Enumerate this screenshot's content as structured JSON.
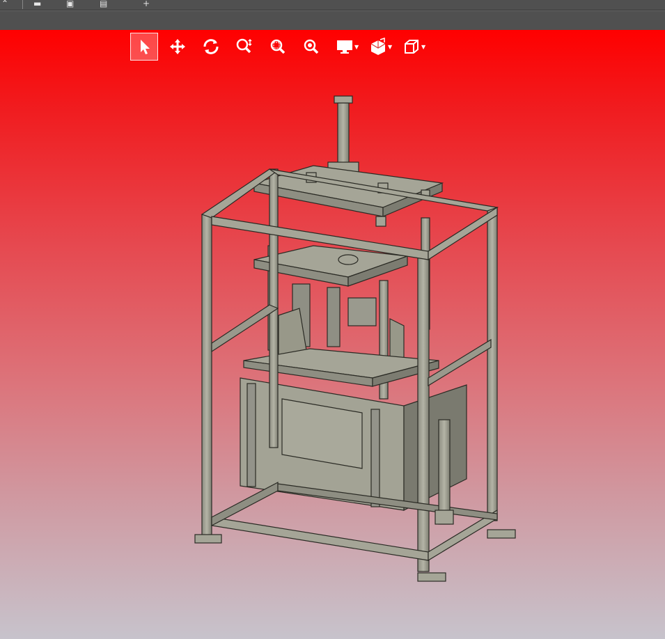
{
  "app": {
    "topbar_icons": [
      "menu-icon",
      "save-icon",
      "print-icon",
      "add-icon"
    ]
  },
  "viewer": {
    "background_top_color": "#ff0000",
    "background_bottom_color": "#c7c3cc",
    "toolbar": [
      {
        "name": "select-tool",
        "icon": "pointer-icon",
        "active": true
      },
      {
        "name": "pan-tool",
        "icon": "move-icon",
        "active": false
      },
      {
        "name": "rotate-tool",
        "icon": "rotate-icon",
        "active": false
      },
      {
        "name": "zoom-tool",
        "icon": "zoom-icon",
        "active": false
      },
      {
        "name": "zoom-window-tool",
        "icon": "zoom-window-icon",
        "active": false
      },
      {
        "name": "zoom-fit-tool",
        "icon": "zoom-fit-icon",
        "active": false
      },
      {
        "name": "display-mode-dropdown",
        "icon": "monitor-icon",
        "active": false
      },
      {
        "name": "section-dropdown",
        "icon": "section-box-icon",
        "active": false
      },
      {
        "name": "view-cube-dropdown",
        "icon": "view-cube-icon",
        "active": false
      }
    ],
    "model": {
      "description_color": "#a5a597"
    }
  }
}
